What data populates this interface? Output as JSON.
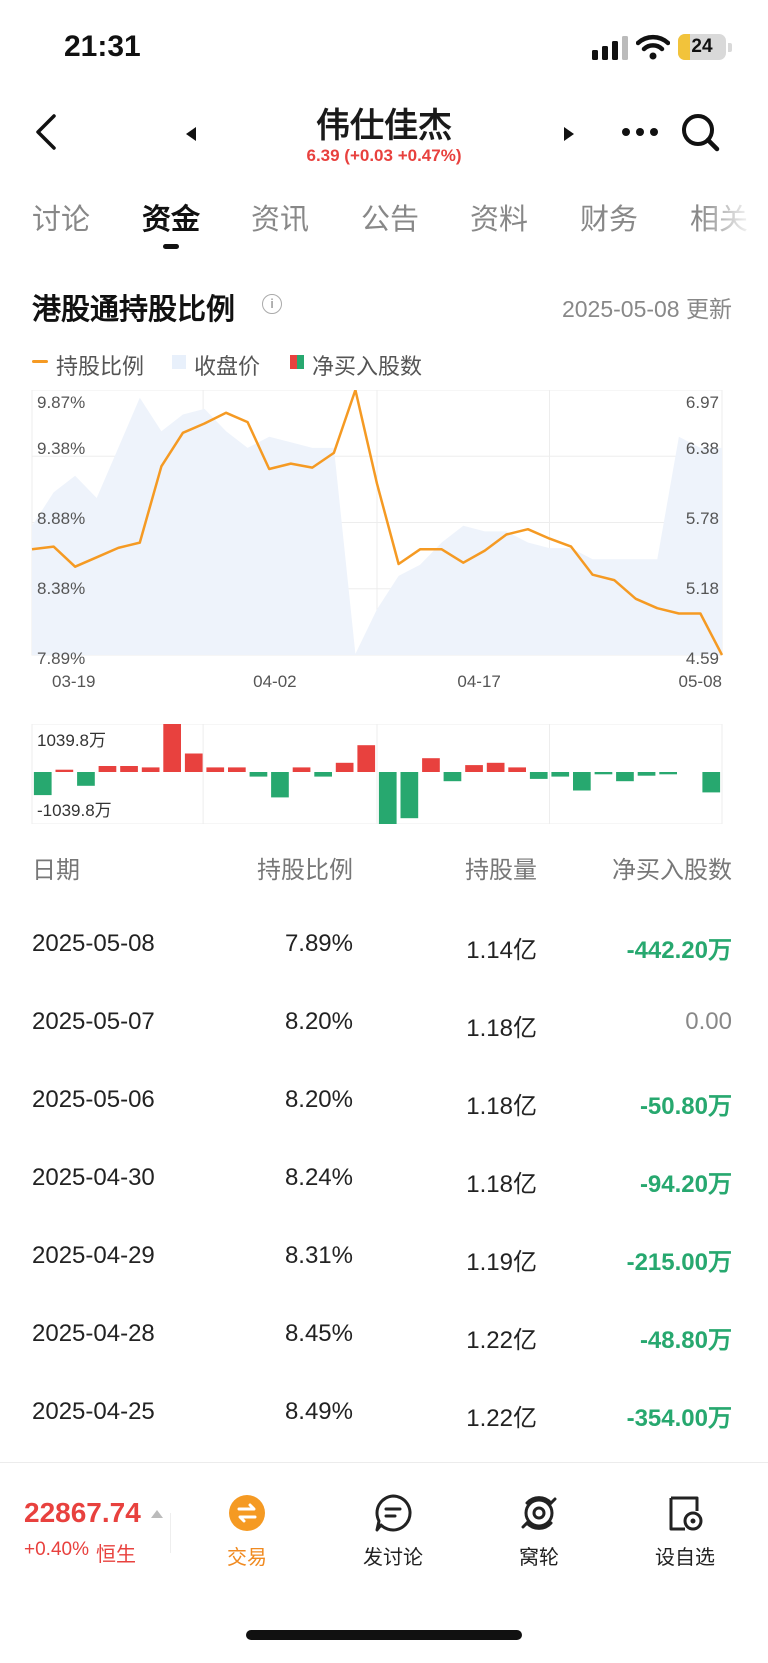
{
  "status_bar": {
    "time": "21:31",
    "battery": "24",
    "battery_level": 0.24
  },
  "header": {
    "stock_name": "伟仕佳杰",
    "quote": "6.39 (+0.03 +0.47%)",
    "icons": [
      "back-icon",
      "prev-stock-icon",
      "next-stock-icon",
      "more-icon",
      "search-icon"
    ]
  },
  "tabs": [
    {
      "label": "讨论",
      "active": false
    },
    {
      "label": "资金",
      "active": true
    },
    {
      "label": "资讯",
      "active": false
    },
    {
      "label": "公告",
      "active": false
    },
    {
      "label": "资料",
      "active": false
    },
    {
      "label": "财务",
      "active": false
    },
    {
      "label": "相关",
      "active": false
    }
  ],
  "section": {
    "title": "港股通持股比例",
    "update": "2025-05-08 更新"
  },
  "legend": [
    {
      "label": "持股比例",
      "color": "#f59a23"
    },
    {
      "label": "收盘价",
      "color": "#e8f0fb"
    },
    {
      "label": "净买入股数",
      "colors": [
        "#e8413e",
        "#27a86f"
      ]
    }
  ],
  "chart_data": [
    {
      "type": "line",
      "title": "",
      "x_ticks": [
        "03-19",
        "04-02",
        "04-17",
        "05-08"
      ],
      "y_left_ticks": [
        "9.87%",
        "9.38%",
        "8.88%",
        "8.38%",
        "7.89%"
      ],
      "y_right_ticks": [
        "6.97",
        "6.38",
        "5.78",
        "5.18",
        "4.59"
      ],
      "y_left_range": [
        7.89,
        9.87
      ],
      "y_right_range": [
        4.59,
        6.97
      ],
      "series": [
        {
          "name": "持股比例",
          "color": "#f59a23",
          "values": [
            8.68,
            8.7,
            8.55,
            8.62,
            8.69,
            8.73,
            9.3,
            9.55,
            9.62,
            9.7,
            9.63,
            9.28,
            9.32,
            9.29,
            9.4,
            9.87,
            9.17,
            8.57,
            8.68,
            8.68,
            8.58,
            8.67,
            8.79,
            8.83,
            8.76,
            8.7,
            8.49,
            8.45,
            8.31,
            8.24,
            8.2,
            8.2,
            7.89
          ]
        },
        {
          "name": "收盘价",
          "color": "#eef3fb",
          "values": [
            5.75,
            6.05,
            6.2,
            6.0,
            6.45,
            6.9,
            6.6,
            6.75,
            6.8,
            6.6,
            6.45,
            6.55,
            6.5,
            6.45,
            6.45,
            4.6,
            5.0,
            5.3,
            5.4,
            5.6,
            5.75,
            5.7,
            5.7,
            5.6,
            5.55,
            5.55,
            5.45,
            5.45,
            5.45,
            5.45,
            6.55,
            6.45,
            6.45
          ]
        }
      ]
    },
    {
      "type": "bar",
      "title": "",
      "ylabel": "",
      "y_ticks": [
        "1039.8万",
        "-1039.8万"
      ],
      "y_range": [
        -1039.8,
        1039.8
      ],
      "x_ticks": [
        "03-19",
        "04-02",
        "04-17",
        "05-08"
      ],
      "series": [
        {
          "name": "净买入股数",
          "values": [
            -500,
            50,
            -300,
            130,
            130,
            100,
            1039.8,
            400,
            100,
            100,
            -100,
            -550,
            100,
            -100,
            200,
            580,
            -1150,
            -1000,
            300,
            -200,
            150,
            200,
            100,
            -150,
            -100,
            -400,
            -50,
            -200,
            -80,
            -50,
            0,
            -442.2
          ]
        }
      ]
    }
  ],
  "table": {
    "headers": [
      "日期",
      "持股比例",
      "持股量",
      "净买入股数"
    ],
    "rows": [
      {
        "date": "2025-05-08",
        "ratio": "7.89%",
        "volume": "1.14亿",
        "net": "-442.20万",
        "net_type": "neg"
      },
      {
        "date": "2025-05-07",
        "ratio": "8.20%",
        "volume": "1.18亿",
        "net": "0.00",
        "net_type": "zero"
      },
      {
        "date": "2025-05-06",
        "ratio": "8.20%",
        "volume": "1.18亿",
        "net": "-50.80万",
        "net_type": "neg"
      },
      {
        "date": "2025-04-30",
        "ratio": "8.24%",
        "volume": "1.18亿",
        "net": "-94.20万",
        "net_type": "neg"
      },
      {
        "date": "2025-04-29",
        "ratio": "8.31%",
        "volume": "1.19亿",
        "net": "-215.00万",
        "net_type": "neg"
      },
      {
        "date": "2025-04-28",
        "ratio": "8.45%",
        "volume": "1.22亿",
        "net": "-48.80万",
        "net_type": "neg"
      },
      {
        "date": "2025-04-25",
        "ratio": "8.49%",
        "volume": "1.22亿",
        "net": "-354.00万",
        "net_type": "neg"
      }
    ]
  },
  "bottom_bar": {
    "index_value": "22867.74",
    "index_change": "+0.40%",
    "index_name": "恒生",
    "items": [
      {
        "label": "交易",
        "icon": "trade-icon"
      },
      {
        "label": "发讨论",
        "icon": "post-discussion-icon"
      },
      {
        "label": "窝轮",
        "icon": "warrant-icon"
      },
      {
        "label": "设自选",
        "icon": "add-watchlist-icon"
      }
    ]
  },
  "colors": {
    "up": "#e8413e",
    "down": "#27a86f",
    "accent": "#f59a23"
  }
}
